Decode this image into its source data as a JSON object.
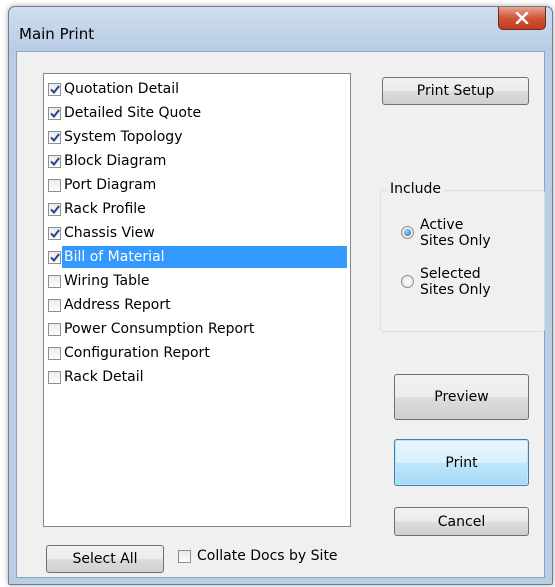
{
  "window": {
    "title": "Main Print",
    "close_icon": "x-icon"
  },
  "report_list": {
    "items": [
      {
        "label": "Quotation Detail",
        "checked": true
      },
      {
        "label": "Detailed Site Quote",
        "checked": true
      },
      {
        "label": "System Topology",
        "checked": true
      },
      {
        "label": "Block Diagram",
        "checked": true
      },
      {
        "label": "Port Diagram",
        "checked": false
      },
      {
        "label": "Rack Profile",
        "checked": true
      },
      {
        "label": "Chassis View",
        "checked": true
      },
      {
        "label": "Bill of Material",
        "checked": true,
        "selected": true
      },
      {
        "label": "Wiring Table",
        "checked": false
      },
      {
        "label": "Address Report",
        "checked": false
      },
      {
        "label": "Power Consumption Report",
        "checked": false
      },
      {
        "label": "Configuration Report",
        "checked": false
      },
      {
        "label": "Rack Detail",
        "checked": false
      }
    ]
  },
  "buttons": {
    "print_setup": "Print Setup",
    "preview": "Preview",
    "print": "Print",
    "cancel": "Cancel",
    "select_all": "Select All"
  },
  "include_group": {
    "label": "Include",
    "options": [
      {
        "label": "Active Sites Only",
        "selected": true
      },
      {
        "label": "Selected Sites Only",
        "selected": false
      }
    ]
  },
  "collate": {
    "label": "Collate Docs by Site",
    "checked": false
  },
  "colors": {
    "selection": "#3399ff",
    "frame": "#b9cde4",
    "dialog_bg": "#f0f0f0"
  }
}
